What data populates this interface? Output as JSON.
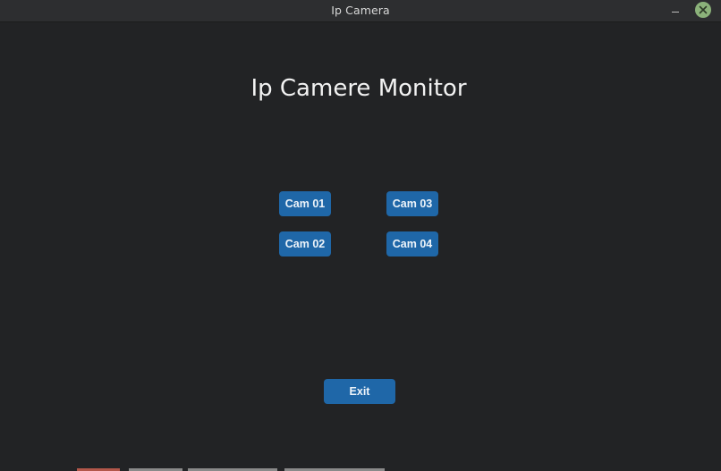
{
  "window": {
    "title": "Ip Camera"
  },
  "app": {
    "heading": "Ip Camere Monitor",
    "buttons": {
      "cam01": "Cam 01",
      "cam02": "Cam 02",
      "cam03": "Cam 03",
      "cam04": "Cam 04",
      "exit": "Exit"
    }
  },
  "colors": {
    "background": "#222325",
    "titlebar": "#2d2e30",
    "button": "#1f67a8",
    "close_button": "#8bb27a"
  },
  "icons": {
    "minimize": "minimize-icon",
    "close": "close-icon"
  }
}
